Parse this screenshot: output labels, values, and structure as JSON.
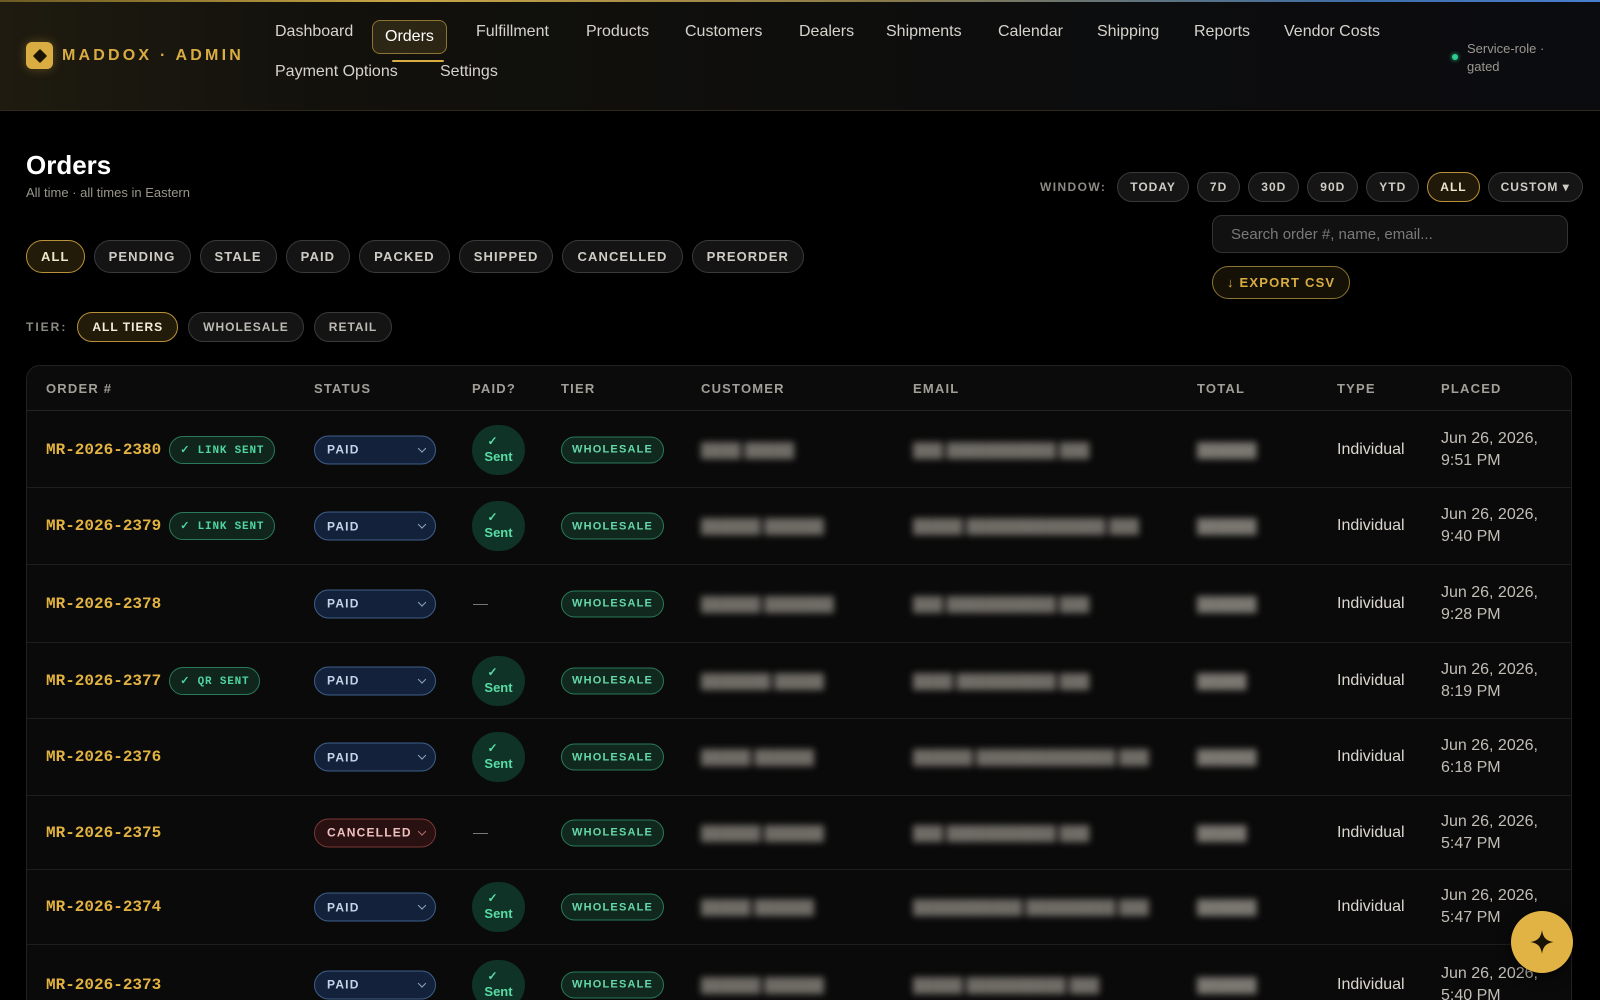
{
  "brand": {
    "name": "MADDOX · ADMIN"
  },
  "nav": [
    {
      "label": "Dashboard"
    },
    {
      "label": "Orders"
    },
    {
      "label": "Fulfillment"
    },
    {
      "label": "Products"
    },
    {
      "label": "Customers"
    },
    {
      "label": "Dealers"
    },
    {
      "label": "Shipments"
    },
    {
      "label": "Calendar"
    },
    {
      "label": "Shipping"
    },
    {
      "label": "Reports"
    },
    {
      "label": "Vendor Costs"
    },
    {
      "label": "Payment Options"
    },
    {
      "label": "Settings"
    }
  ],
  "nav_active": "Orders",
  "service_status": "Service-role · gated",
  "page": {
    "title": "Orders",
    "subtitle": "All time · all times in Eastern"
  },
  "window": {
    "label": "WINDOW:",
    "options": [
      "TODAY",
      "7D",
      "30D",
      "90D",
      "YTD",
      "ALL",
      "CUSTOM ▾"
    ],
    "selected": "ALL"
  },
  "search": {
    "placeholder": "Search order #, name, email..."
  },
  "export_label": "↓ EXPORT CSV",
  "status_filters": [
    "ALL",
    "PENDING",
    "STALE",
    "PAID",
    "PACKED",
    "SHIPPED",
    "CANCELLED",
    "PREORDER"
  ],
  "status_filter_selected": "ALL",
  "tier_filter": {
    "label": "TIER:",
    "options": [
      "ALL TIERS",
      "WHOLESALE",
      "RETAIL"
    ],
    "selected": "ALL TIERS"
  },
  "table": {
    "columns": [
      "ORDER #",
      "STATUS",
      "PAID?",
      "TIER",
      "CUSTOMER",
      "EMAIL",
      "TOTAL",
      "TYPE",
      "PLACED"
    ],
    "rows": [
      {
        "order": "MR-2026-2380",
        "badge": "✓ LINK SENT",
        "status": "PAID",
        "paid": "Sent",
        "tier": "WHOLESALE",
        "customer": "████ █████",
        "email": "███ ███████████ ███",
        "total": "██████",
        "type": "Individual",
        "placed": [
          "Jun 26, 2026,",
          "9:51 PM"
        ]
      },
      {
        "order": "MR-2026-2379",
        "badge": "✓ LINK SENT",
        "status": "PAID",
        "paid": "Sent",
        "tier": "WHOLESALE",
        "customer": "██████ ██████",
        "email": "█████ ██████████████ ███",
        "total": "██████",
        "type": "Individual",
        "placed": [
          "Jun 26, 2026,",
          "9:40 PM"
        ]
      },
      {
        "order": "MR-2026-2378",
        "badge": "",
        "status": "PAID",
        "paid": "—",
        "tier": "WHOLESALE",
        "customer": "██████ ███████",
        "email": "███ ███████████ ███",
        "total": "██████",
        "type": "Individual",
        "placed": [
          "Jun 26, 2026,",
          "9:28 PM"
        ]
      },
      {
        "order": "MR-2026-2377",
        "badge": "✓ QR SENT",
        "status": "PAID",
        "paid": "Sent",
        "tier": "WHOLESALE",
        "customer": "███████ █████",
        "email": "████ ██████████ ███",
        "total": "█████",
        "type": "Individual",
        "placed": [
          "Jun 26, 2026,",
          "8:19 PM"
        ]
      },
      {
        "order": "MR-2026-2376",
        "badge": "",
        "status": "PAID",
        "paid": "Sent",
        "tier": "WHOLESALE",
        "customer": "█████ ██████",
        "email": "██████ ██████████████ ███",
        "total": "██████",
        "type": "Individual",
        "placed": [
          "Jun 26, 2026,",
          "6:18 PM"
        ]
      },
      {
        "order": "MR-2026-2375",
        "badge": "",
        "status": "CANCELLED",
        "paid": "—",
        "tier": "WHOLESALE",
        "customer": "██████ ██████",
        "email": "███ ███████████ ███",
        "total": "█████",
        "type": "Individual",
        "placed": [
          "Jun 26, 2026,",
          "5:47 PM"
        ]
      },
      {
        "order": "MR-2026-2374",
        "badge": "",
        "status": "PAID",
        "paid": "Sent",
        "tier": "WHOLESALE",
        "customer": "█████ ██████",
        "email": "███████████ █████████ ███",
        "total": "██████",
        "type": "Individual",
        "placed": [
          "Jun 26, 2026,",
          "5:47 PM"
        ]
      },
      {
        "order": "MR-2026-2373",
        "badge": "",
        "status": "PAID",
        "paid": "Sent",
        "tier": "WHOLESALE",
        "customer": "██████ ██████",
        "email": "█████ ██████████ ███",
        "total": "██████",
        "type": "Individual",
        "placed": [
          "Jun 26, 2026,",
          "5:40 PM"
        ]
      }
    ]
  },
  "fab_icon": "sparkle-icon",
  "colors": {
    "accent": "#d9ad42",
    "success": "#4fd6a0",
    "danger": "#7a3636",
    "info": "#3d5e8a"
  }
}
